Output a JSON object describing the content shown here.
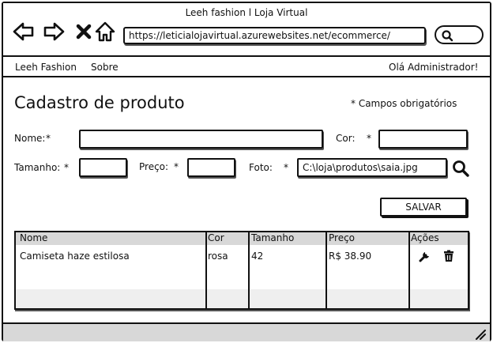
{
  "browser": {
    "title": "Leeh fashion l Loja Virtual",
    "url": "https://leticialojavirtual.azurewebsites.net/ecommerce/"
  },
  "menu": {
    "left_items": [
      "Leeh Fashion",
      "Sobre"
    ],
    "greeting": "Olá Administrador!"
  },
  "form": {
    "title": "Cadastro de produto",
    "required_note": "* Campos obrigatórios",
    "name_label": "Nome:",
    "color_label": "Cor:",
    "size_label": "Tamanho:",
    "price_label": "Preço:",
    "photo_label": "Foto:",
    "asterisk": "*",
    "name_value": "",
    "color_value": "",
    "size_value": "",
    "price_value": "",
    "photo_value": "C:\\loja\\produtos\\saia.jpg",
    "save_label": "SALVAR"
  },
  "table": {
    "columns": [
      "Nome",
      "Cor",
      "Tamanho",
      "Preço",
      "Ações"
    ],
    "rows": [
      [
        "Camiseta haze estilosa",
        "rosa",
        "42",
        "R$ 38.90"
      ]
    ]
  },
  "icons": {
    "back": "arrow-left-icon",
    "forward": "arrow-right-icon",
    "stop": "close-icon",
    "home": "home-icon",
    "search": "search-icon",
    "edit": "wrench-icon",
    "delete": "trash-icon"
  }
}
